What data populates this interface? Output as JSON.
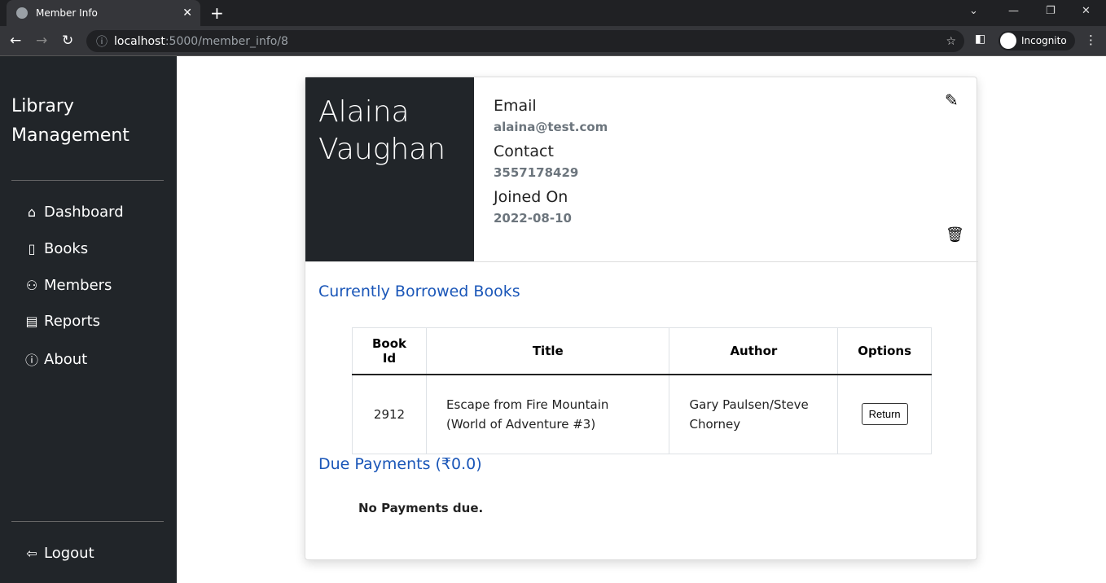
{
  "browser": {
    "tab_title": "Member Info",
    "url_host": "localhost",
    "url_path": ":5000/member_info/8",
    "profile": "Incognito"
  },
  "sidebar": {
    "brand": "Library Management",
    "items": [
      {
        "label": "Dashboard",
        "icon": "house-icon"
      },
      {
        "label": "Books",
        "icon": "journal-icon"
      },
      {
        "label": "Members",
        "icon": "people-icon"
      },
      {
        "label": "Reports",
        "icon": "clipboard-data-icon"
      },
      {
        "label": "About",
        "icon": "info-circle-icon"
      }
    ],
    "logout": "Logout"
  },
  "member": {
    "name": "Alaina Vaughan",
    "email_label": "Email",
    "email": "alaina@test.com",
    "contact_label": "Contact",
    "contact": "3557178429",
    "joined_label": "Joined On",
    "joined": "2022-08-10"
  },
  "borrowed": {
    "heading": "Currently Borrowed Books",
    "columns": [
      "Book Id",
      "Title",
      "Author",
      "Options"
    ],
    "rows": [
      {
        "id": "2912",
        "title": "Escape from Fire Mountain (World of Adventure #3)",
        "author": "Gary Paulsen/Steve Chorney",
        "action": "Return"
      }
    ]
  },
  "payments": {
    "heading": "Due Payments (₹0.0)",
    "empty": "No Payments due."
  }
}
